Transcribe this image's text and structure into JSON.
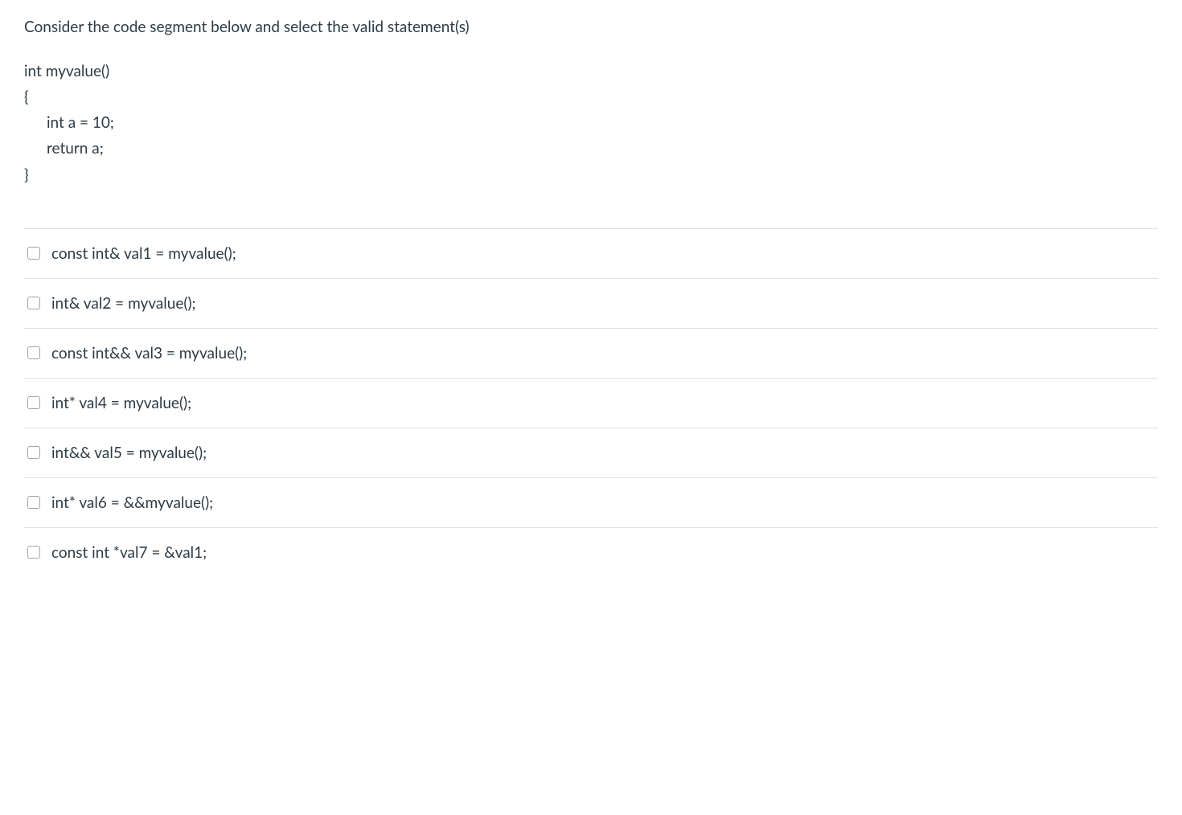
{
  "question": {
    "prompt": "Consider the code segment below and select the valid statement(s)",
    "code": {
      "line1": "int myvalue()",
      "line2": "{",
      "line3": "int a = 10;",
      "line4": "return a;",
      "line5": "}"
    }
  },
  "answers": [
    {
      "label": "const int& val1 = myvalue();"
    },
    {
      "label": "int& val2 = myvalue();"
    },
    {
      "label": "const int&& val3 = myvalue();"
    },
    {
      "label": "int* val4 = myvalue();"
    },
    {
      "label": "int&& val5 = myvalue();"
    },
    {
      "label": "int* val6 = &&myvalue();"
    },
    {
      "label": "const int *val7 = &val1;"
    }
  ]
}
